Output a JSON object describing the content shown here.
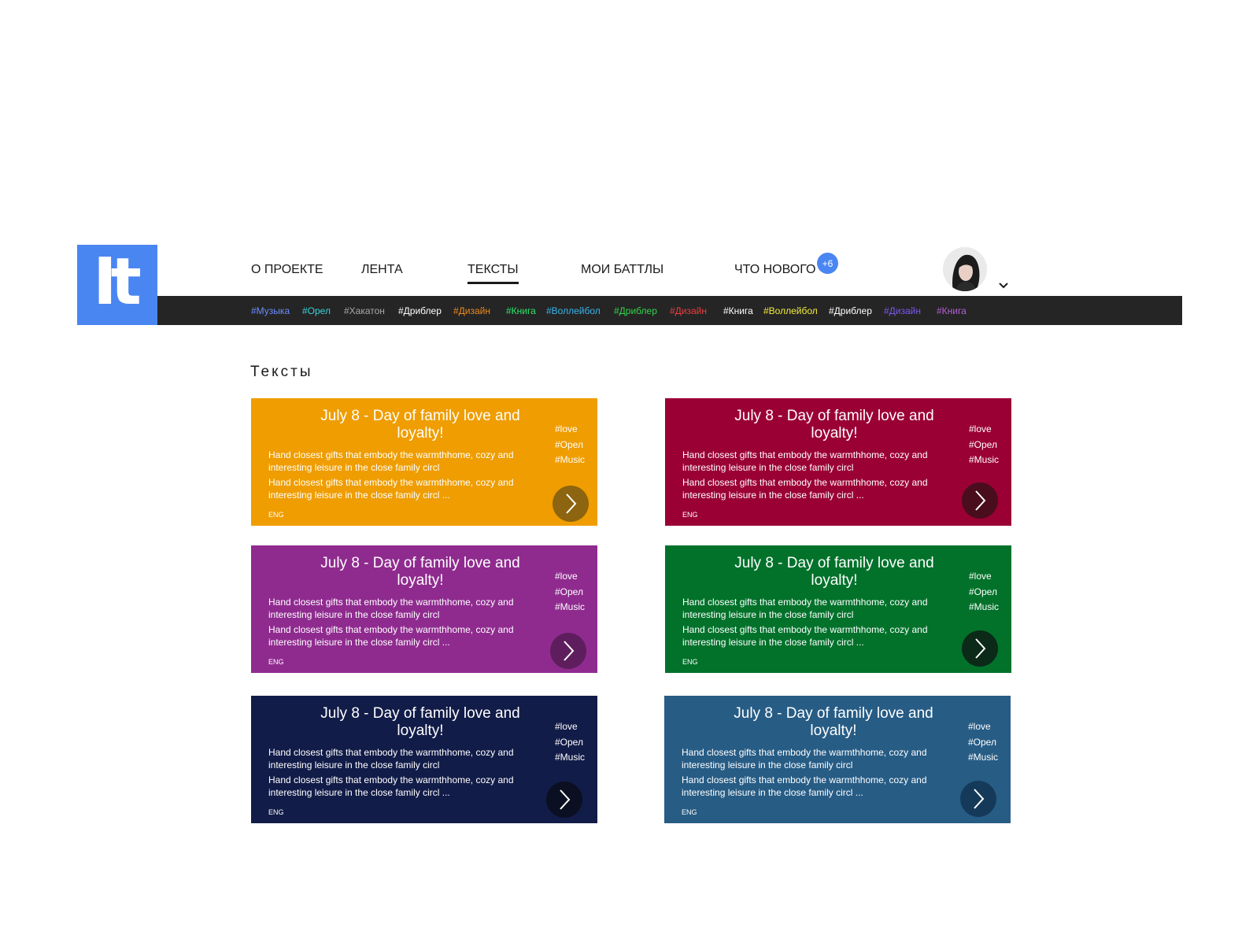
{
  "logo": {
    "text": "It"
  },
  "nav": {
    "items": [
      {
        "label": "О ПРОЕКТЕ"
      },
      {
        "label": "ЛЕНТА"
      },
      {
        "label": "ТЕКСТЫ",
        "active": true
      },
      {
        "label": "МОИ БАТТЛЫ"
      },
      {
        "label": "ЧТО НОВОГО"
      }
    ],
    "badge": "+6",
    "accent": "#4a86f2"
  },
  "user": {
    "avatar_icon": "user-avatar",
    "menu_icon": "chevron-down-icon"
  },
  "tagbar": {
    "background": "#252525",
    "tags": [
      {
        "label": "#Музыка",
        "color": "#6b8cff"
      },
      {
        "label": "#Орел",
        "color": "#36d3dc"
      },
      {
        "label": "#Хакатон",
        "color": "#a8a8a8"
      },
      {
        "label": "#Дриблер",
        "color": "#ffffff"
      },
      {
        "label": "#Дизайн",
        "color": "#f08a1e"
      },
      {
        "label": "#Книга",
        "color": "#2ee66a"
      },
      {
        "label": "#Воллейбол",
        "color": "#35b7f0"
      },
      {
        "label": "#Дриблер",
        "color": "#2fd64a"
      },
      {
        "label": "#Дизайн",
        "color": "#ee3f3f"
      },
      {
        "label": "#Книга",
        "color": "#ffffff"
      },
      {
        "label": "#Воллейбол",
        "color": "#f3ec3c"
      },
      {
        "label": "#Дриблер",
        "color": "#ffffff"
      },
      {
        "label": "#Дизайн",
        "color": "#7b59f0"
      },
      {
        "label": "#Книга",
        "color": "#b65fd6"
      }
    ]
  },
  "section": {
    "title": "Тексты"
  },
  "cards": [
    {
      "title": "July 8 - Day of family love and loyalty!",
      "text1": "Hand closest gifts that embody the warmthhome, cozy and interesting leisure in the close family circl",
      "text2": "Hand closest gifts that embody the warmthhome, cozy and interesting leisure in the close family circl ...",
      "tags": [
        "#love",
        "#Орел",
        "#Music"
      ],
      "lang": "ENG",
      "color": "#ef9d00",
      "button_color": "#8d6410"
    },
    {
      "title": "July 8 - Day of family love and loyalty!",
      "text1": "Hand closest gifts that embody the warmthhome, cozy and interesting leisure in the close family circl",
      "text2": "Hand closest gifts that embody the warmthhome, cozy and interesting leisure in the close family circl ...",
      "tags": [
        "#love",
        "#Орел",
        "#Music"
      ],
      "lang": "ENG",
      "color": "#9b0035",
      "button_color": "#4a0d1e"
    },
    {
      "title": "July 8 - Day of family love and loyalty!",
      "text1": "Hand closest gifts that embody the warmthhome, cozy and interesting leisure in the close family circl",
      "text2": "Hand closest gifts that embody the warmthhome, cozy and interesting leisure in the close family circl ...",
      "tags": [
        "#love",
        "#Орел",
        "#Music"
      ],
      "lang": "ENG",
      "color": "#8f2b8f",
      "button_color": "#5e1e5e"
    },
    {
      "title": "July 8 - Day of family love and loyalty!",
      "text1": "Hand closest gifts that embody the warmthhome, cozy and interesting leisure in the close family circl",
      "text2": "Hand closest gifts that embody the warmthhome, cozy and interesting leisure in the close family circl ...",
      "tags": [
        "#love",
        "#Орел",
        "#Music"
      ],
      "lang": "ENG",
      "color": "#02722b",
      "button_color": "#0b2a17"
    },
    {
      "title": "July 8 - Day of family love and loyalty!",
      "text1": "Hand closest gifts that embody the warmthhome, cozy and interesting leisure in the close family circl",
      "text2": "Hand closest gifts that embody the warmthhome, cozy and interesting leisure in the close family circl ...",
      "tags": [
        "#love",
        "#Орел",
        "#Music"
      ],
      "lang": "ENG",
      "color": "#121c48",
      "button_color": "#0a0f22"
    },
    {
      "title": "July 8 - Day of family love and loyalty!",
      "text1": "Hand closest gifts that embody the warmthhome, cozy and interesting leisure in the close family circl",
      "text2": "Hand closest gifts that embody the warmthhome, cozy and interesting leisure in the close family circl ...",
      "tags": [
        "#love",
        "#Орел",
        "#Music"
      ],
      "lang": "ENG",
      "color": "#275c85",
      "button_color": "#153a59"
    }
  ]
}
